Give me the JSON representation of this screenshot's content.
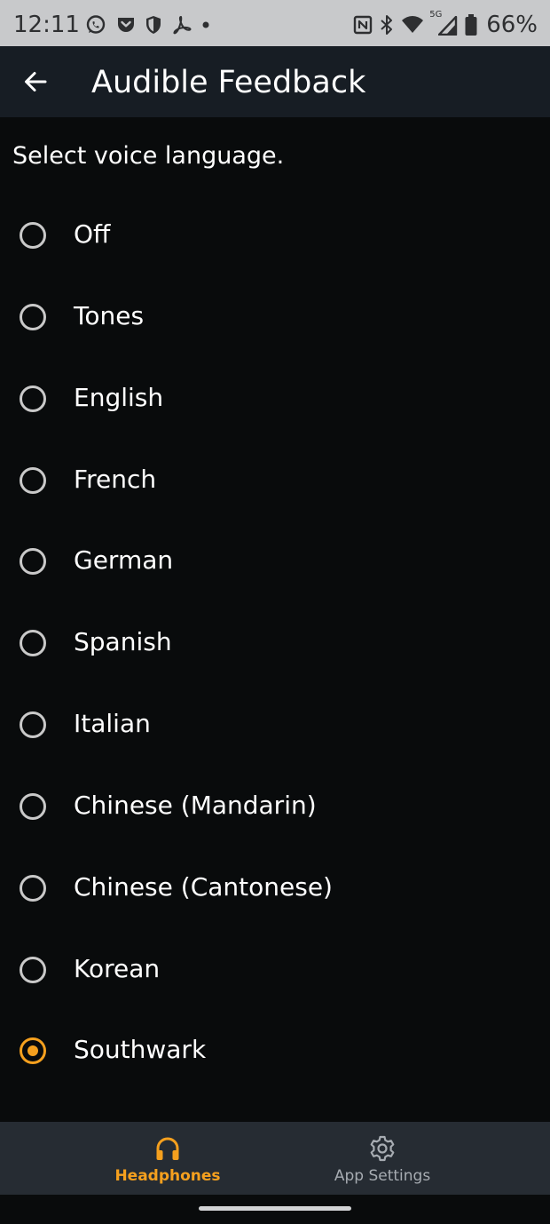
{
  "status_bar": {
    "time": "12:11",
    "battery_text": "66%",
    "network_label": "5G",
    "left_icons": [
      "whatsapp-icon",
      "pocket-icon",
      "shield-icon",
      "acrobat-icon",
      "dot-icon"
    ],
    "right_icons": [
      "nfc-icon",
      "bluetooth-icon",
      "wifi-icon",
      "cell-signal-icon",
      "battery-icon"
    ]
  },
  "app_bar": {
    "title": "Audible Feedback",
    "back_icon": "arrow-left-icon"
  },
  "prompt": "Select voice language.",
  "options": [
    {
      "label": "Off",
      "selected": false
    },
    {
      "label": "Tones",
      "selected": false
    },
    {
      "label": "English",
      "selected": false
    },
    {
      "label": "French",
      "selected": false
    },
    {
      "label": "German",
      "selected": false
    },
    {
      "label": "Spanish",
      "selected": false
    },
    {
      "label": "Italian",
      "selected": false
    },
    {
      "label": "Chinese (Mandarin)",
      "selected": false
    },
    {
      "label": "Chinese (Cantonese)",
      "selected": false
    },
    {
      "label": "Korean",
      "selected": false
    },
    {
      "label": "Southwark",
      "selected": true
    }
  ],
  "bottom_nav": {
    "items": [
      {
        "label": "Headphones",
        "icon": "headphones-icon",
        "active": true
      },
      {
        "label": "App Settings",
        "icon": "gear-icon",
        "active": false
      }
    ]
  },
  "colors": {
    "accent": "#f5a01e",
    "background": "#090b0c",
    "app_bar": "#171d24",
    "bottom_nav": "#262c33",
    "status_bar": "#c8c9cb"
  }
}
